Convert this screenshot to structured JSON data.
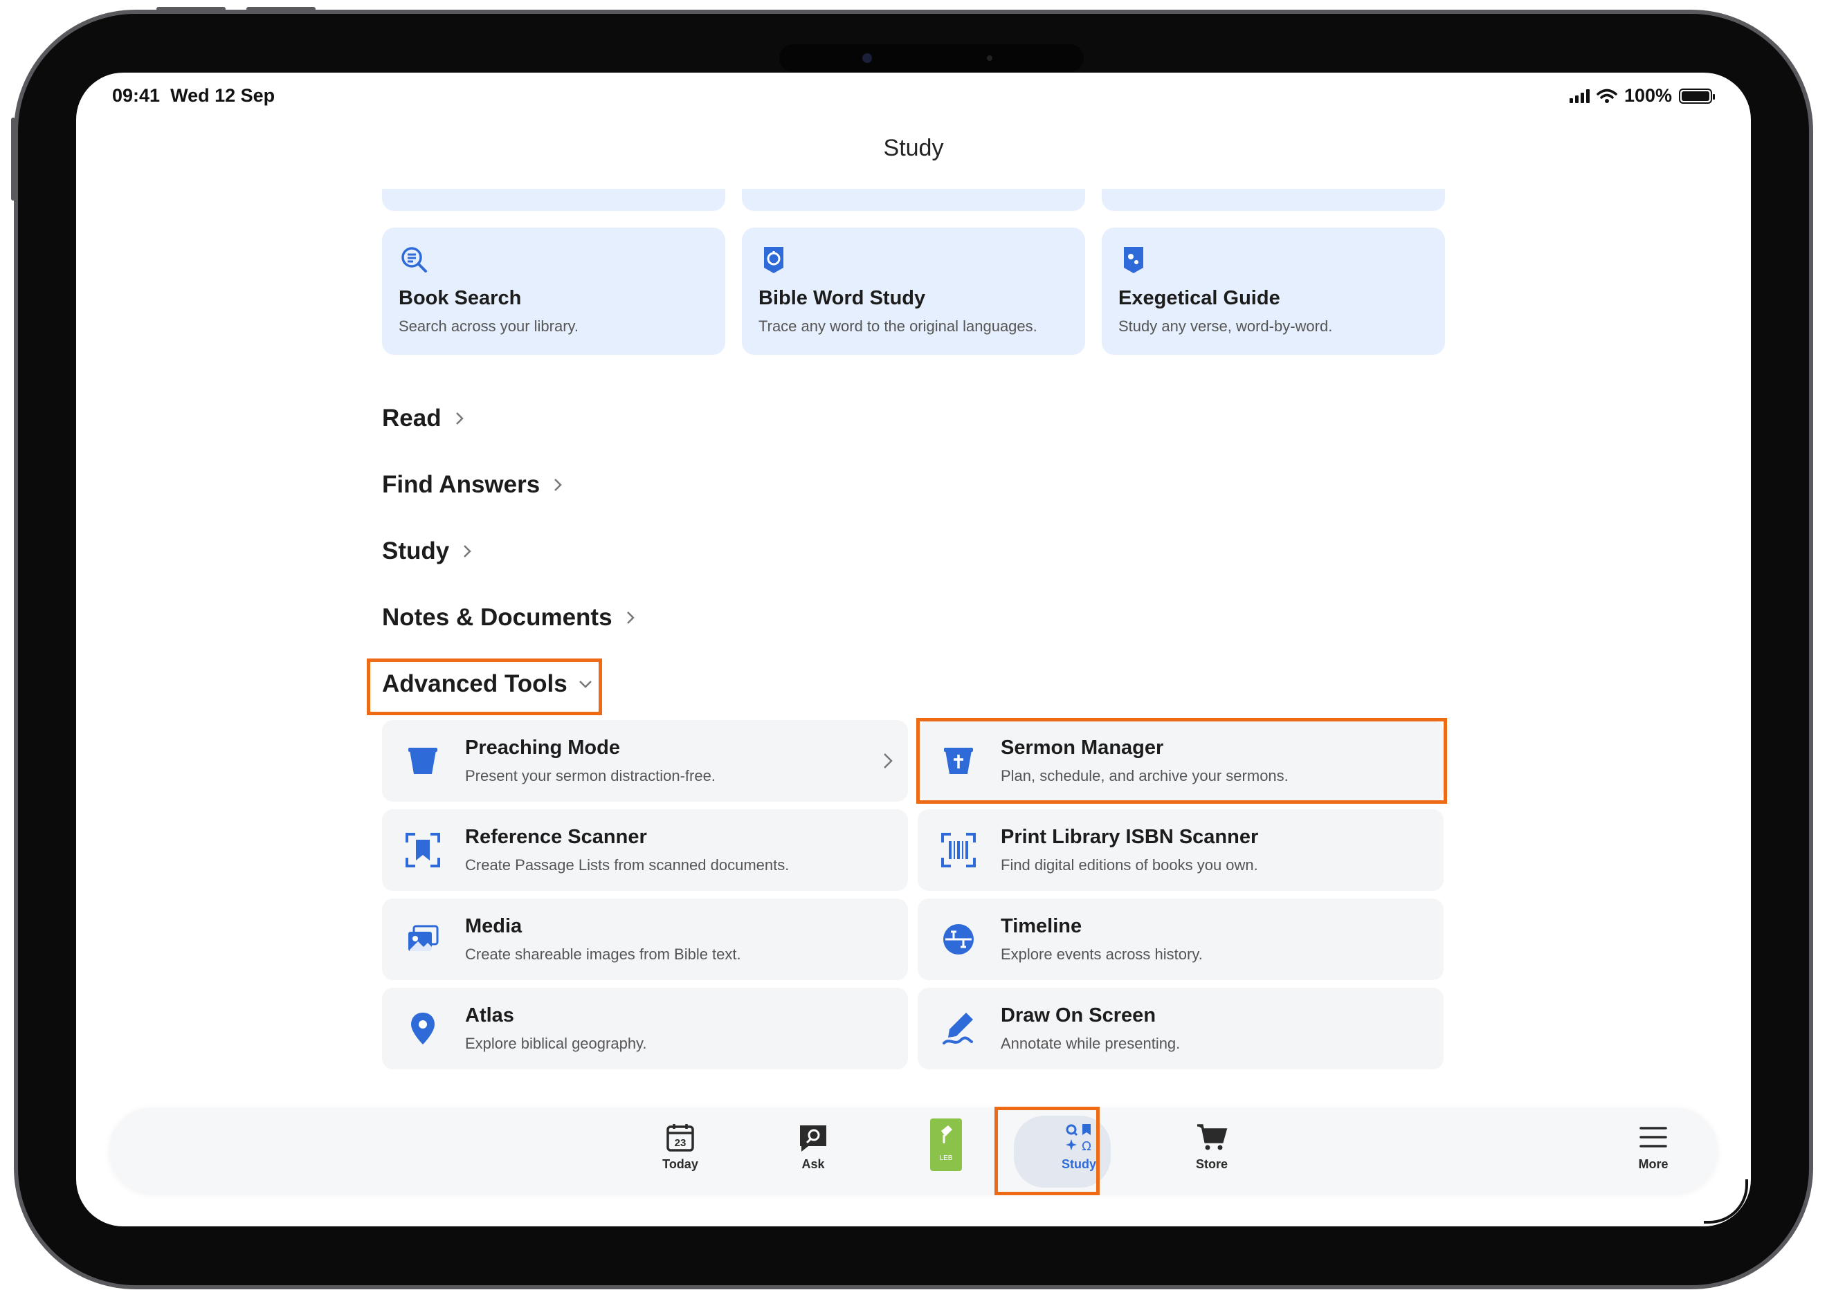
{
  "status_bar": {
    "time": "09:41",
    "date": "Wed 12 Sep",
    "battery": "100%",
    "battery_level": 1.0
  },
  "page": {
    "title": "Study"
  },
  "feature_cards": [
    {
      "title": "Book Search",
      "subtitle": "Search across your library.",
      "icon": "search-icon"
    },
    {
      "title": "Bible Word Study",
      "subtitle": "Trace any word to the original languages.",
      "icon": "word-study-icon"
    },
    {
      "title": "Exegetical Guide",
      "subtitle": "Study any verse, word-by-word.",
      "icon": "exegetical-guide-icon"
    }
  ],
  "sections": [
    {
      "label": "Read",
      "state": "collapsed"
    },
    {
      "label": "Find Answers",
      "state": "collapsed"
    },
    {
      "label": "Study",
      "state": "collapsed"
    },
    {
      "label": "Notes & Documents",
      "state": "collapsed"
    },
    {
      "label": "Advanced Tools",
      "state": "expanded"
    }
  ],
  "advanced_tools": [
    {
      "title": "Preaching Mode",
      "subtitle": "Present your sermon distraction-free.",
      "icon": "pulpit-icon",
      "has_chevron": true
    },
    {
      "title": "Sermon Manager",
      "subtitle": "Plan, schedule, and archive your sermons.",
      "icon": "sermon-manager-icon"
    },
    {
      "title": "Reference Scanner",
      "subtitle": "Create Passage Lists from scanned documents.",
      "icon": "scan-bookmark-icon"
    },
    {
      "title": "Print Library ISBN Scanner",
      "subtitle": "Find digital editions of books you own.",
      "icon": "barcode-scan-icon"
    },
    {
      "title": "Media",
      "subtitle": "Create shareable images from Bible text.",
      "icon": "image-stack-icon"
    },
    {
      "title": "Timeline",
      "subtitle": "Explore events across history.",
      "icon": "timeline-icon"
    },
    {
      "title": "Atlas",
      "subtitle": "Explore biblical geography.",
      "icon": "map-pin-icon"
    },
    {
      "title": "Draw On Screen",
      "subtitle": "Annotate while presenting.",
      "icon": "pen-draw-icon"
    }
  ],
  "tab_bar": {
    "items": [
      {
        "label": "Today",
        "icon": "calendar-icon",
        "badge": "23"
      },
      {
        "label": "Ask",
        "icon": "ask-search-icon"
      },
      {
        "label": "",
        "icon": "bible-book-icon",
        "badge": "LEB"
      },
      {
        "label": "Study",
        "icon": "study-tools-icon",
        "active": true
      },
      {
        "label": "Store",
        "icon": "cart-icon"
      },
      {
        "label": "More",
        "icon": "menu-icon"
      }
    ]
  },
  "colors": {
    "accent": "#2f6bd8",
    "highlight": "#ef6a15",
    "card_bg": "#e6effd",
    "tool_bg": "#f4f5f7",
    "bible_green": "#8bc34a"
  }
}
